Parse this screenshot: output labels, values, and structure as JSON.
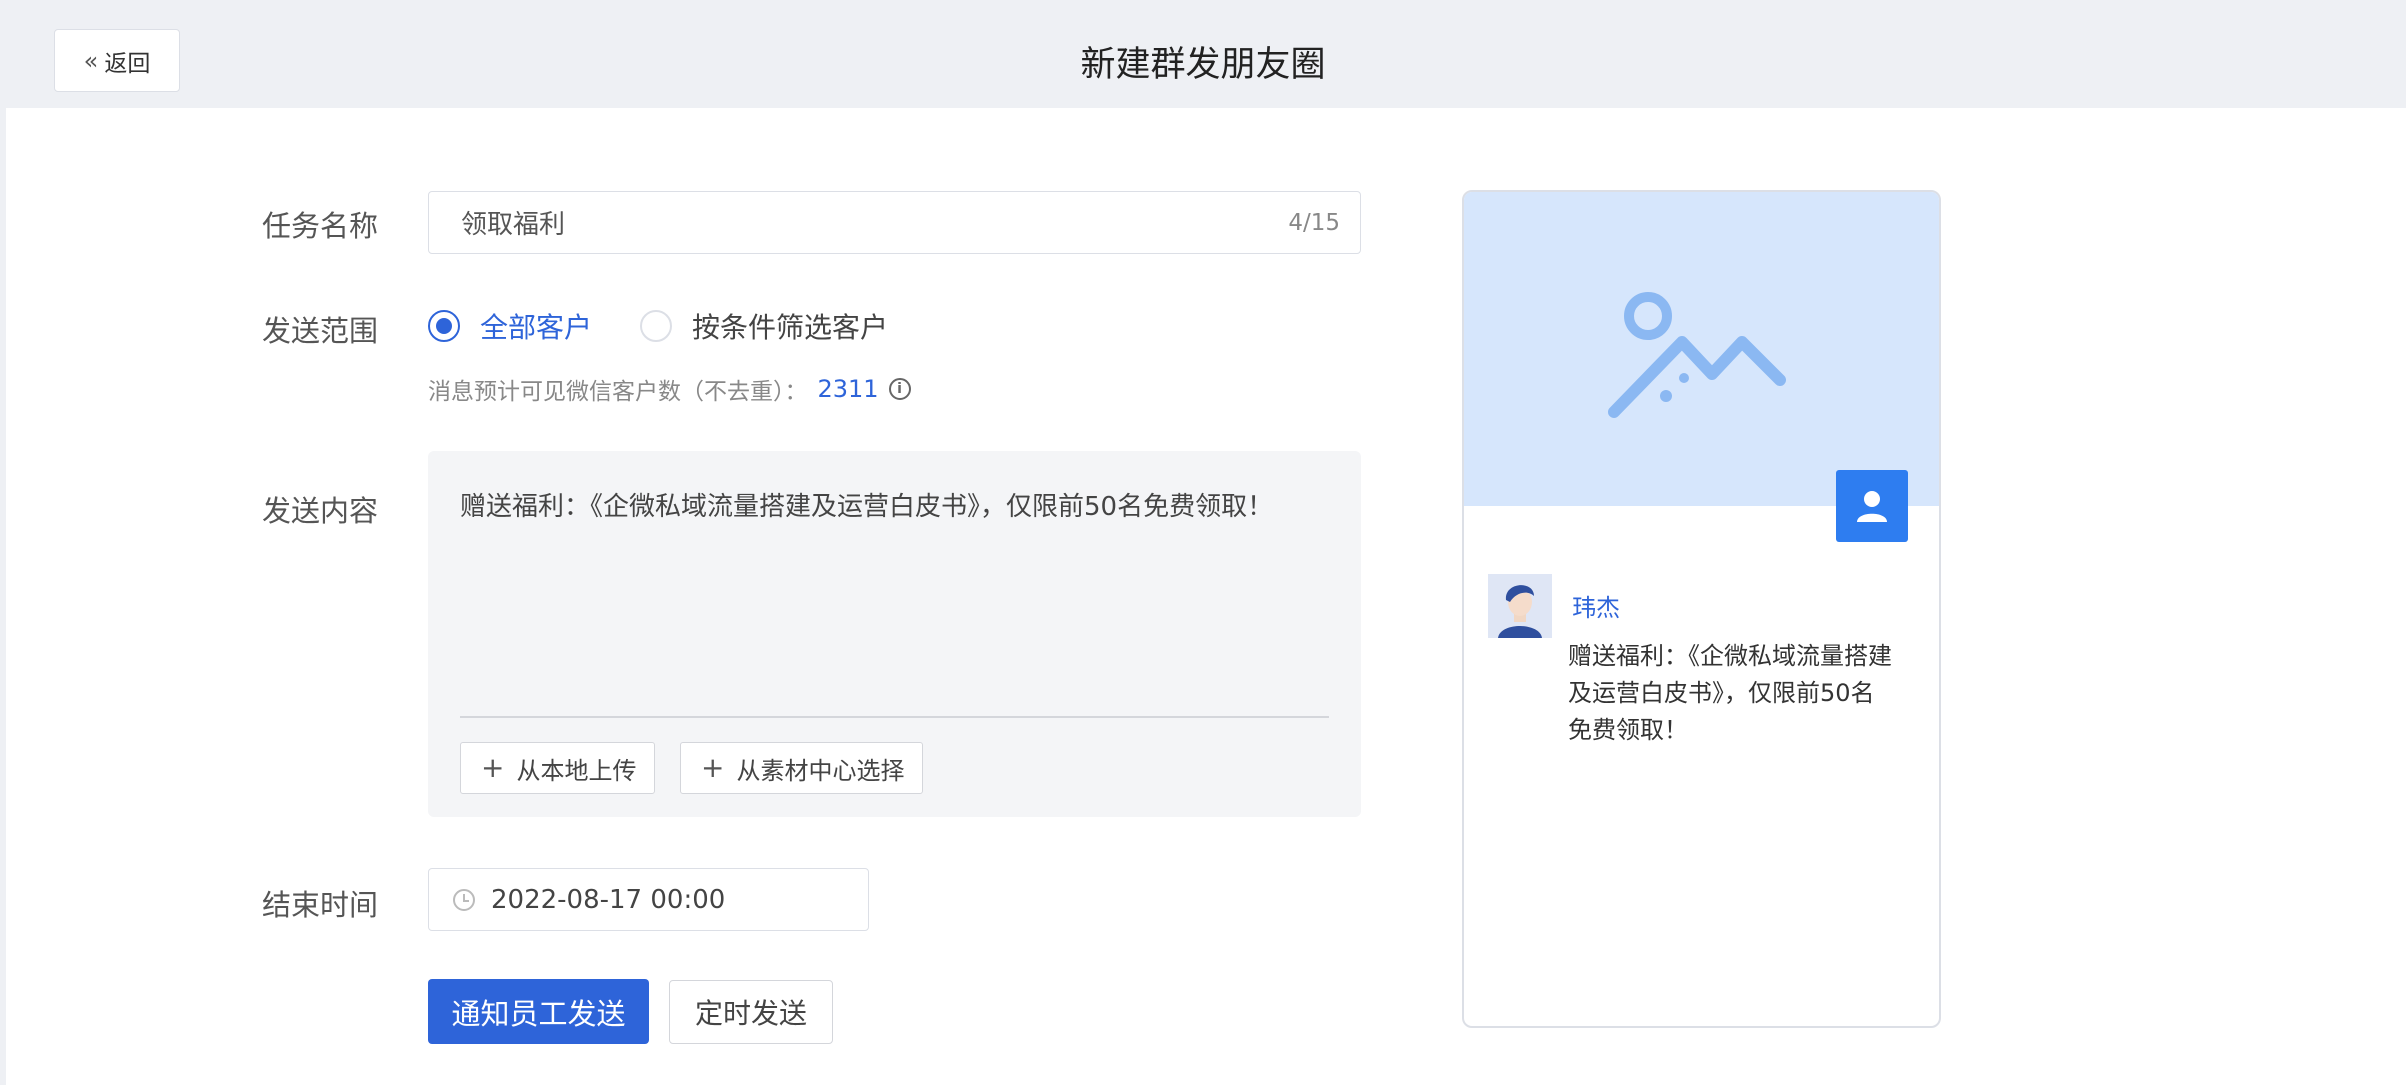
{
  "header": {
    "back_label": "返回",
    "title": "新建群发朋友圈"
  },
  "form": {
    "task_name": {
      "label": "任务名称",
      "value": "领取福利",
      "counter": "4/15"
    },
    "scope": {
      "label": "发送范围",
      "options": [
        {
          "label": "全部客户",
          "checked": true
        },
        {
          "label": "按条件筛选客户",
          "checked": false
        }
      ],
      "hint_text": "消息预计可见微信客户数（不去重）：",
      "hint_count": "2311"
    },
    "content": {
      "label": "发送内容",
      "text": "赠送福利：《企微私域流量搭建及运营白皮书》，仅限前50名免费领取！",
      "upload_local": "从本地上传",
      "upload_library": "从素材中心选择"
    },
    "end_time": {
      "label": "结束时间",
      "value": "2022-08-17 00:00"
    },
    "actions": {
      "primary": "通知员工发送",
      "secondary": "定时发送"
    }
  },
  "preview": {
    "author": "玮杰",
    "text": "赠送福利：《企微私域流量搭建及运营白皮书》，仅限前50名免费领取！"
  },
  "colors": {
    "accent": "#2e64d9",
    "cover_bg": "#d6e6fc",
    "avatar_tile": "#2e7df0"
  }
}
